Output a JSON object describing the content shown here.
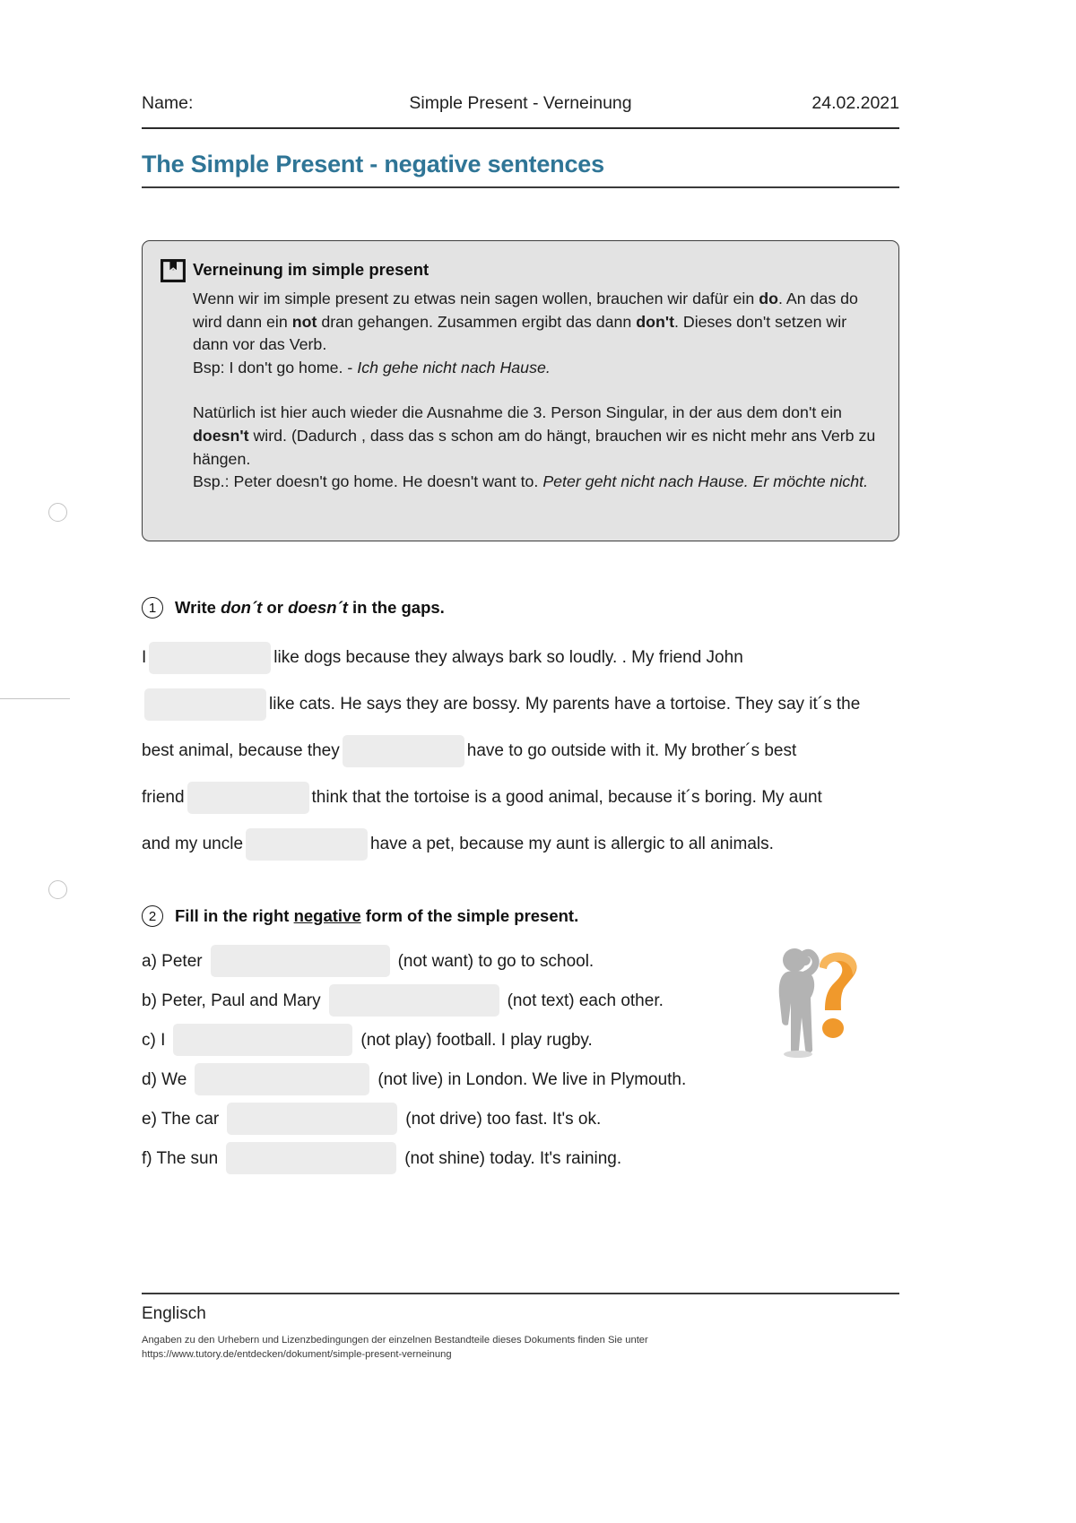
{
  "header": {
    "name_label": "Name:",
    "doc_subject": "Simple Present - Verneinung",
    "date": "24.02.2021"
  },
  "title": "The Simple Present - negative sentences",
  "infobox": {
    "icon": "book-icon",
    "title": "Verneinung im simple present",
    "p1_a": "Wenn wir im simple present zu etwas nein sagen wollen, brauchen wir dafür ein ",
    "p1_b_do": "do",
    "p1_c": ". An das do wird dann ein ",
    "p1_d_not": "not",
    "p1_e": " dran gehangen. Zusammen ergibt das dann ",
    "p1_f_dont": "don't",
    "p1_g": ". Dieses don't setzen wir dann vor das Verb.",
    "p2_a": "Bsp: I don't go home. - ",
    "p2_b_italic": "Ich gehe nicht nach Hause.",
    "p3_a": "Natürlich ist hier auch wieder die Ausnahme die 3. Person Singular, in der aus dem don't ein ",
    "p3_b_doesnt": "doesn't",
    "p3_c": " wird. (Dadurch , dass das s schon am do hängt, brauchen wir es nicht mehr ans Verb zu hängen.",
    "p4_a": "Bsp.: Peter doesn't go home. He doesn't want to. ",
    "p4_b_italic": "Peter geht nicht nach Hause. Er möchte nicht."
  },
  "task1": {
    "number": "1",
    "head_a": "Write ",
    "head_italic_1": "don´t",
    "head_b": " or ",
    "head_italic_2": "doesn´t",
    "head_c": " in the gaps.",
    "seg1": "I",
    "seg2": "like dogs because they always bark so loudly. . My friend John",
    "seg3": "like cats. He says they are bossy. My parents have a tortoise. They say it´s the",
    "seg4": "best animal, because they",
    "seg5": "have to go outside with it. My brother´s best",
    "seg6": "friend",
    "seg7": "think that the tortoise is a good animal, because it´s boring. My aunt",
    "seg8": "and my uncle",
    "seg9": "have a pet, because my aunt is allergic to all animals."
  },
  "task2": {
    "number": "2",
    "head_a": "Fill in the right ",
    "head_underline": "negative",
    "head_b": " form of the simple present.",
    "items": [
      {
        "prefix": "a) Peter",
        "suffix": "(not want) to go to school.",
        "blank_width": 200
      },
      {
        "prefix": "b) Peter, Paul and Mary",
        "suffix": "(not text) each other.",
        "blank_width": 190
      },
      {
        "prefix": "c) I",
        "suffix": "(not play) football. I play rugby.",
        "blank_width": 200
      },
      {
        "prefix": "d) We",
        "suffix": "(not live) in London. We live in Plymouth.",
        "blank_width": 195
      },
      {
        "prefix": "e) The car",
        "suffix": "(not drive) too fast. It's ok.",
        "blank_width": 190
      },
      {
        "prefix": "f) The sun",
        "suffix": "(not shine) today. It's raining.",
        "blank_width": 190
      }
    ]
  },
  "illustration": "thinking-person-question-mark-icon",
  "footer": {
    "subject": "Englisch",
    "credit_line1": "Angaben zu den Urhebern und Lizenzbedingungen der einzelnen Bestandteile dieses Dokuments finden Sie unter",
    "credit_line2": "https://www.tutory.de/entdecken/dokument/simple-present-verneinung"
  },
  "colors": {
    "title_teal": "#2f7596",
    "infobox_bg": "#e3e3e3",
    "blank_bg": "#ececec"
  }
}
